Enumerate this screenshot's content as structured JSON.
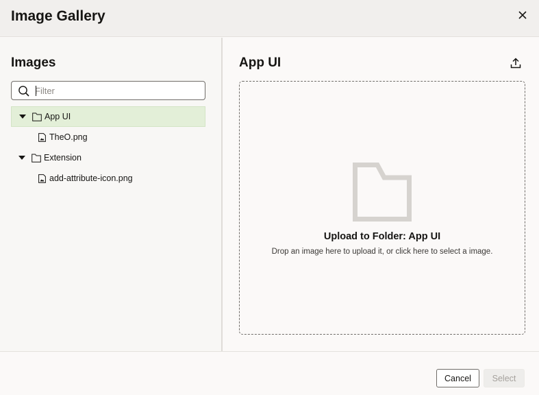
{
  "dialog": {
    "title": "Image Gallery",
    "close_icon": "close-icon"
  },
  "images_panel": {
    "title": "Images",
    "filter": {
      "placeholder": "Filter",
      "value": "",
      "icon": "search-icon"
    },
    "tree": [
      {
        "label": "App UI",
        "type": "folder",
        "expanded": true,
        "selected": true,
        "children": [
          {
            "label": "TheO.png",
            "type": "image-file"
          }
        ]
      },
      {
        "label": "Extension",
        "type": "folder",
        "expanded": true,
        "selected": false,
        "children": [
          {
            "label": "add-attribute-icon.png",
            "type": "image-file"
          }
        ]
      }
    ]
  },
  "folder_panel": {
    "title": "App UI",
    "upload_icon": "upload-icon",
    "dropzone": {
      "title": "Upload to Folder: App UI",
      "subtitle": "Drop an image here to upload it, or click here to select a image."
    }
  },
  "footer": {
    "cancel_label": "Cancel",
    "select_label": "Select",
    "select_enabled": false
  },
  "colors": {
    "selected_row": "#e3efd8",
    "folder_graphic": "#d6d3cf",
    "header_bg": "#f1efed"
  }
}
